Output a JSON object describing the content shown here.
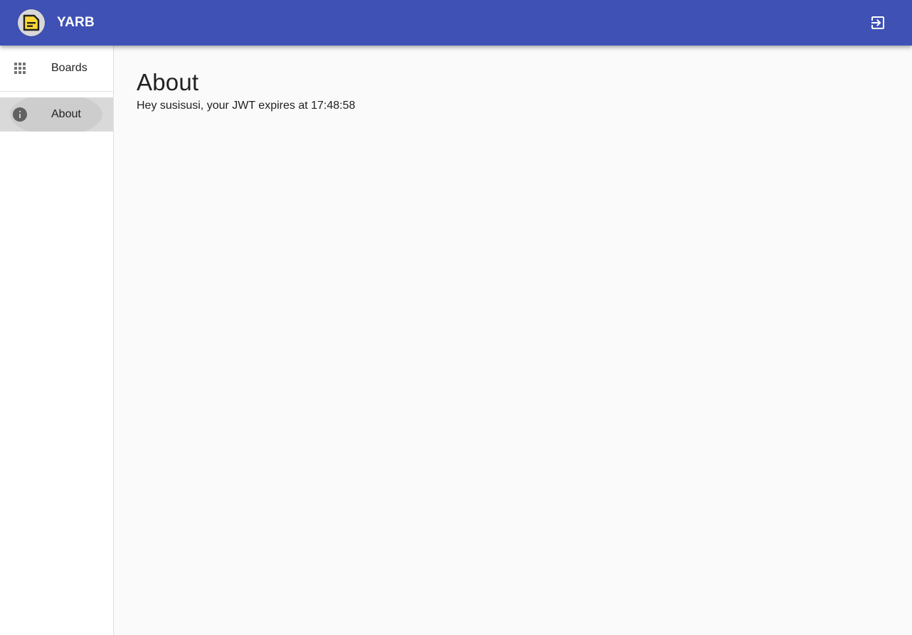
{
  "app": {
    "title": "YARB",
    "logo_icon": "note-icon",
    "brand_color": "#3f51b5",
    "logo_accent": "#fdd835"
  },
  "header": {
    "logout_icon": "exit-to-app-icon"
  },
  "sidebar": {
    "items": [
      {
        "label": "Boards",
        "icon": "apps-grid-icon",
        "selected": false
      },
      {
        "label": "About",
        "icon": "info-icon",
        "selected": true
      }
    ]
  },
  "main": {
    "title": "About",
    "greeting": "Hey susisusi, your JWT expires at 17:48:58"
  }
}
